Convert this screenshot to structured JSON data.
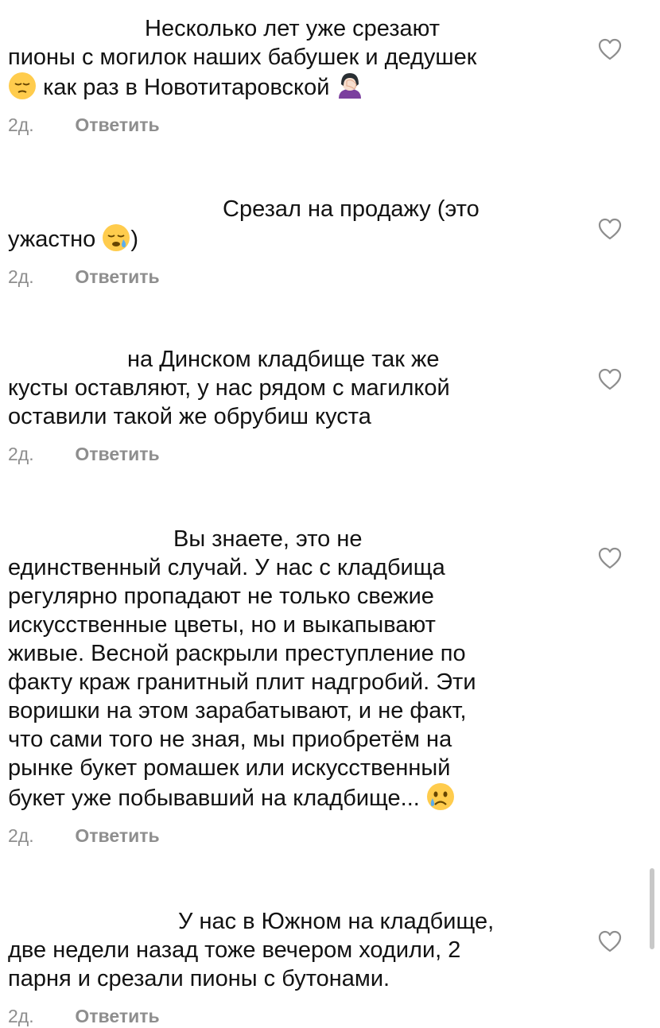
{
  "comments": [
    {
      "lines": [
        "                              Несколько лет уже срезают",
        "пионы с могилок наших бабушек и дедушек",
        " как раз в Новотитаровской"
      ],
      "emoji_start": "pensive-face-emoji",
      "emoji_end": "facepalm-woman-emoji",
      "time": "2д.",
      "reply": "Ответить"
    },
    {
      "lines": [
        "                                             Срезал на продажу (это",
        "ужастно )"
      ],
      "emoji_inline": "sleepy-face-emoji",
      "time": "2д.",
      "reply": "Ответить"
    },
    {
      "lines": [
        "                        на Динском кладбище так же",
        "кусты оставляют, у нас рядом с магилкой",
        "оставили такой же обрубиш куста"
      ],
      "time": "2д.",
      "reply": "Ответить"
    },
    {
      "lines": [
        "                                  Вы знаете, это не",
        "единственный случай. У нас с кладбища",
        "регулярно пропадают не только свежие",
        "искусственные цветы, но и выкапывают",
        "живые. Весной раскрыли преступление по",
        "факту краж гранитный плит надгробий. Эти",
        "воришки на этом зарабатывают, и не факт,",
        "что сами того не зная, мы приобретём на",
        "рынке букет ромашек или искусственный",
        "букет уже побывавший на кладбище... "
      ],
      "emoji_end": "crying-face-emoji",
      "time": "2д.",
      "reply": "Ответить"
    },
    {
      "lines": [
        "                                   У нас в Южном на кладбище,",
        "две недели назад тоже вечером ходили, 2",
        "парня и срезали пионы с бутонами."
      ],
      "time": "2д.",
      "reply": "Ответить"
    }
  ],
  "icons": {
    "like": "heart-outline-icon"
  }
}
